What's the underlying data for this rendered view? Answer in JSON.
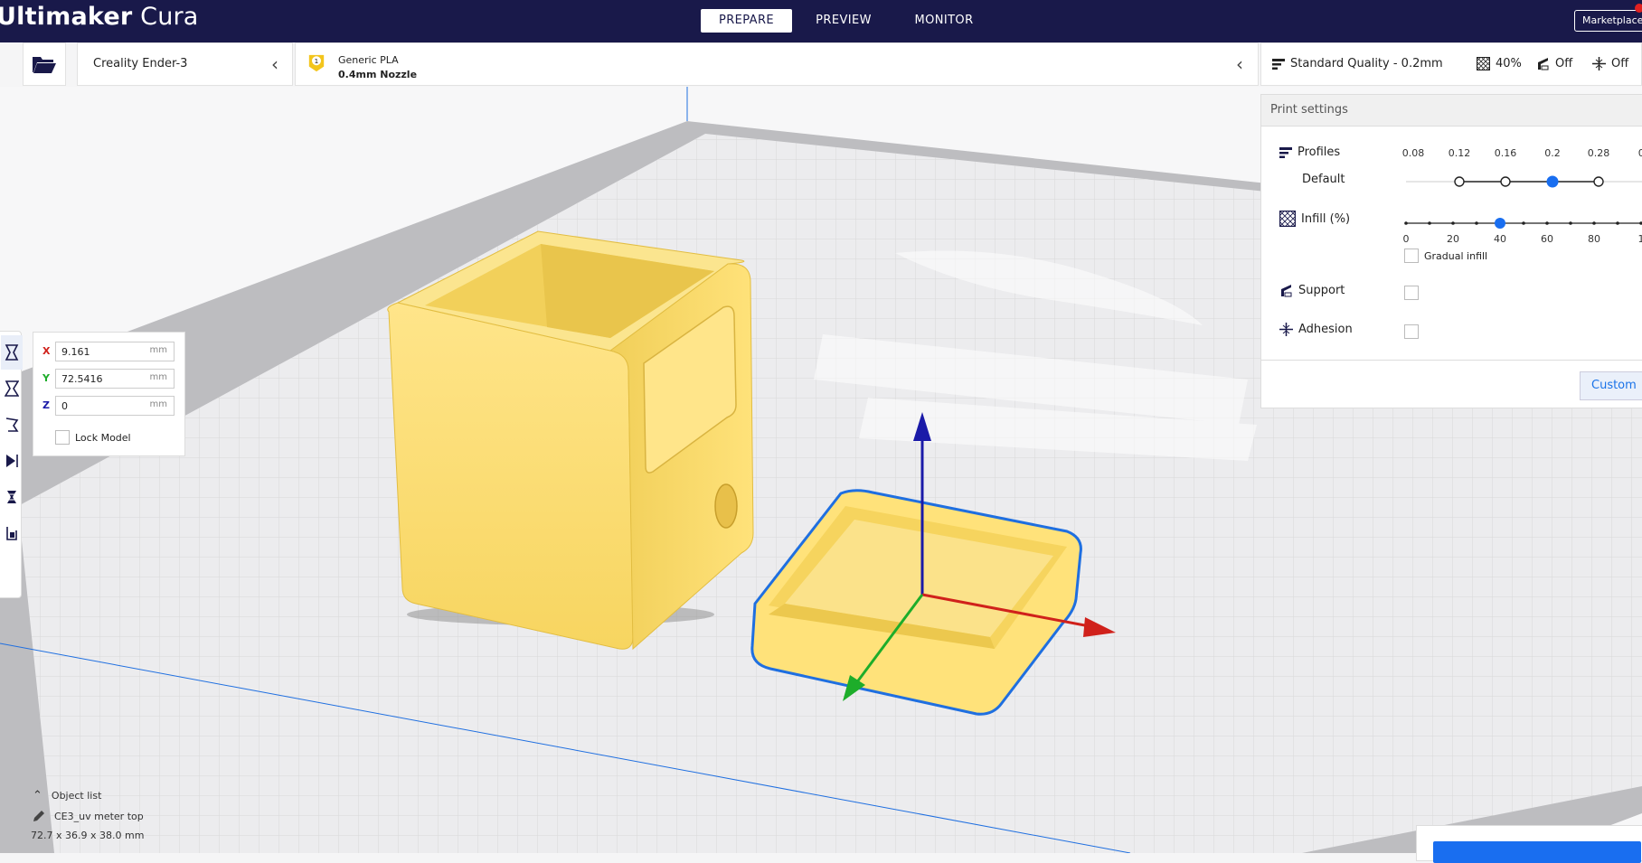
{
  "app": {
    "title_bold": "Ultimaker",
    "title_rest": " Cura",
    "stages": [
      "PREPARE",
      "PREVIEW",
      "MONITOR"
    ],
    "active_stage": "PREPARE",
    "marketplace_label": "Marketplace"
  },
  "header": {
    "printer": "Creality Ender-3",
    "extruder_number": "1",
    "material": "Generic PLA",
    "nozzle": "0.4mm Nozzle",
    "quality": "Standard Quality - 0.2mm",
    "infill_summary": "40%",
    "support_summary": "Off",
    "adhesion_summary": "Off"
  },
  "move_panel": {
    "x_label": "X",
    "x_value": "9.161",
    "y_label": "Y",
    "y_value": "72.5416",
    "z_label": "Z",
    "z_value": "0",
    "unit": "mm",
    "lock_label": "Lock Model"
  },
  "print_settings": {
    "title": "Print settings",
    "profiles_label": "Profiles",
    "profile_default": "Default",
    "layer_heights": [
      "0.08",
      "0.12",
      "0.16",
      "0.2",
      "0.28",
      "0."
    ],
    "selected_layer_height": "0.2",
    "infill_label": "Infill (%)",
    "infill_ticks": [
      "0",
      "20",
      "40",
      "60",
      "80",
      "1"
    ],
    "infill_value": 40,
    "gradual_infill_label": "Gradual infill",
    "support_label": "Support",
    "adhesion_label": "Adhesion",
    "custom_label": "Custom"
  },
  "object_list": {
    "toggle_label": "Object list",
    "object_name": "CE3_uv meter top",
    "dimensions": "72.7 x 36.9 x 38.0 mm"
  },
  "colors": {
    "titlebar": "#19194a",
    "model_yellow": "#ffe27a",
    "selection_blue": "#1f6fe0",
    "accent_blue": "#196ef0",
    "axis_red": "#d0211b",
    "axis_green": "#1dad2a",
    "axis_blue": "#1a1aa8"
  },
  "icons": [
    "open-folder-icon",
    "chevron-left-icon",
    "extruder-badge-icon",
    "quality-icon",
    "infill-icon",
    "support-icon",
    "adhesion-icon",
    "move-tool-icon",
    "scale-tool-icon",
    "rotate-tool-icon",
    "mirror-tool-icon",
    "per-model-settings-icon",
    "support-blocker-icon",
    "pencil-icon",
    "chevron-up-icon"
  ]
}
